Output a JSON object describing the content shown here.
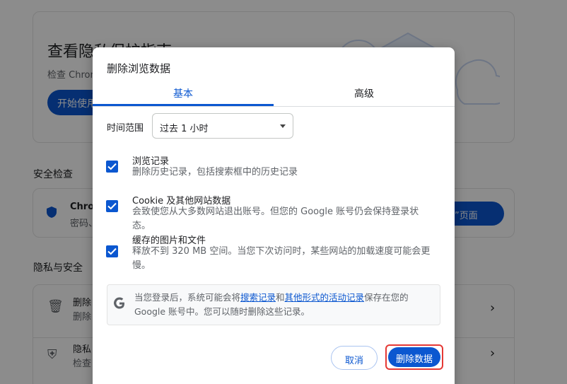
{
  "background": {
    "guide": {
      "title": "查看隐私保护指南",
      "subtitle": "检查 Chrome",
      "button": "开始使用"
    },
    "safety_section": "安全检查",
    "safety_card": {
      "title": "Chrome",
      "subtitle": "密码、",
      "button": "检查”页面"
    },
    "privacy_section": "隐私与安全",
    "privacy_rows": [
      {
        "title": "删除",
        "subtitle": "删除"
      },
      {
        "title": "隐私",
        "subtitle": "检查"
      }
    ]
  },
  "dialog": {
    "title": "删除浏览数据",
    "tabs": [
      "基本",
      "高级"
    ],
    "time_range": {
      "label": "时间范围",
      "value": "过去 1 小时"
    },
    "options": [
      {
        "title": "浏览记录",
        "desc": "删除历史记录，包括搜索框中的历史记录",
        "checked": true
      },
      {
        "title": "Cookie 及其他网站数据",
        "desc": "会致使您从大多数网站退出账号。但您的 Google 账号仍会保持登录状态。",
        "checked": true
      },
      {
        "title": "缓存的图片和文件",
        "desc": "释放不到 320 MB 空间。当您下次访问时，某些网站的加载速度可能会更慢。",
        "checked": true
      }
    ],
    "info": {
      "part1": "当您登录后，系统可能会将",
      "link1": "搜索记录",
      "part2": "和",
      "link2": "其他形式的活动记录",
      "part3": "保存在您的 Google 账号中。您可以随时删除这些记录。"
    },
    "cancel_label": "取消",
    "delete_label": "删除数据"
  },
  "colors": {
    "accent": "#0b57d0",
    "highlight": "#e53935"
  }
}
